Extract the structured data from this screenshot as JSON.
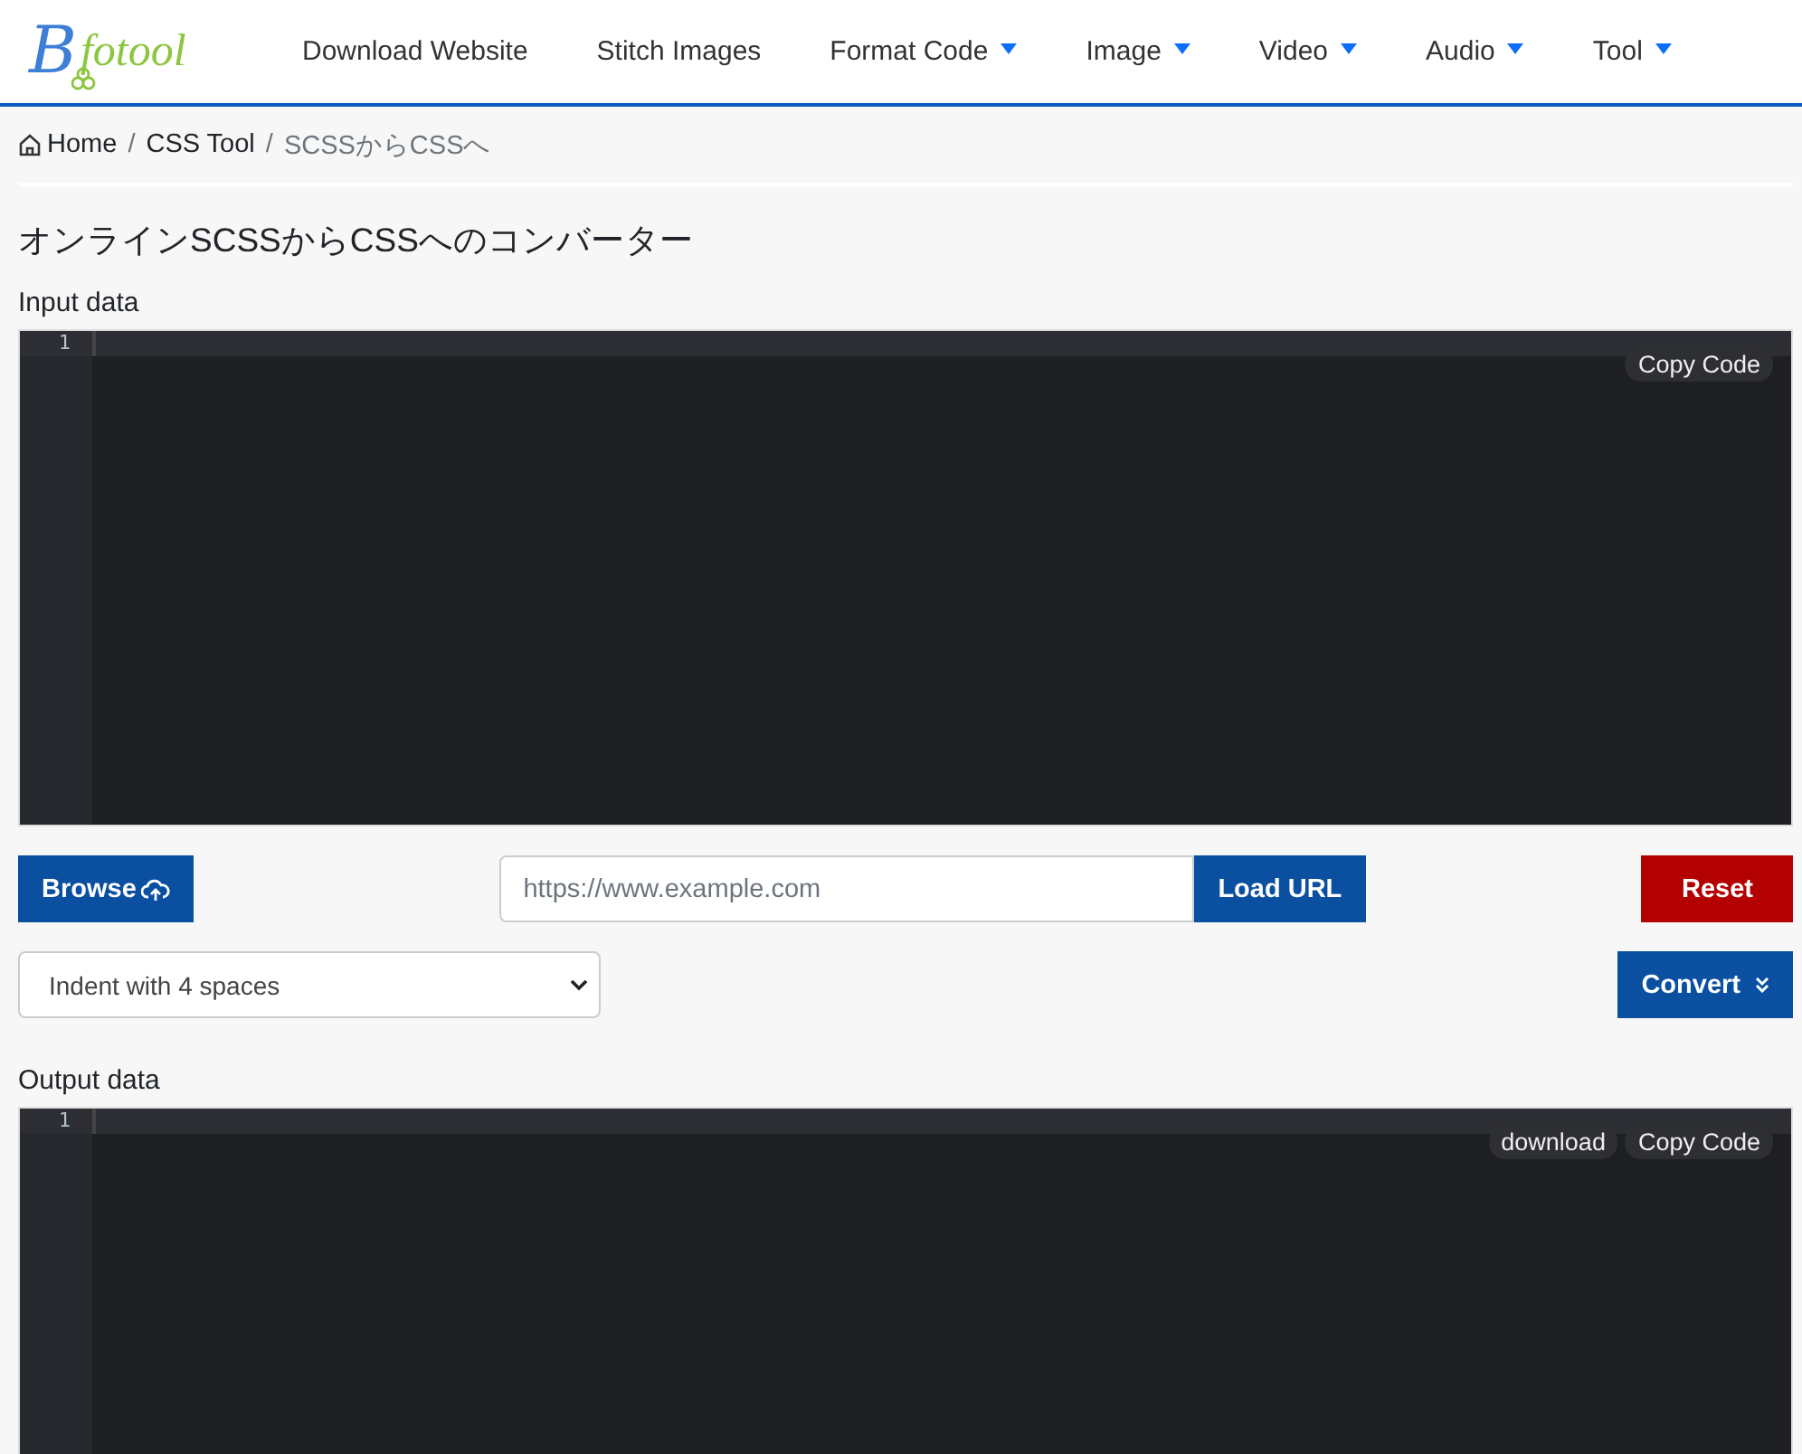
{
  "logo": {
    "mark": "B",
    "text": "fotool"
  },
  "nav": [
    {
      "label": "Download Website",
      "dropdown": false
    },
    {
      "label": "Stitch Images",
      "dropdown": false
    },
    {
      "label": "Format Code",
      "dropdown": true
    },
    {
      "label": "Image",
      "dropdown": true
    },
    {
      "label": "Video",
      "dropdown": true
    },
    {
      "label": "Audio",
      "dropdown": true
    },
    {
      "label": "Tool",
      "dropdown": true
    }
  ],
  "breadcrumb_separators": [
    "/",
    "/"
  ],
  "breadcrumb": [
    {
      "label": "Home",
      "kind": "home"
    },
    {
      "label": "CSS Tool",
      "kind": "link"
    },
    {
      "label": "SCSSからCSSへ",
      "kind": "current"
    }
  ],
  "title": "オンラインSCSSからCSSへのコンバーター",
  "input": {
    "label": "Input data",
    "line_numbers": [
      "1"
    ],
    "actions": [
      "Copy Code"
    ]
  },
  "controls": {
    "browse": "Browse",
    "url": {
      "placeholder": "https://www.example.com"
    },
    "load": "Load URL",
    "reset": "Reset",
    "indent": "Indent with 4 spaces",
    "convert": "Convert"
  },
  "output": {
    "label": "Output data",
    "line_numbers": [
      "1"
    ],
    "actions": [
      "download",
      "Copy Code"
    ]
  }
}
